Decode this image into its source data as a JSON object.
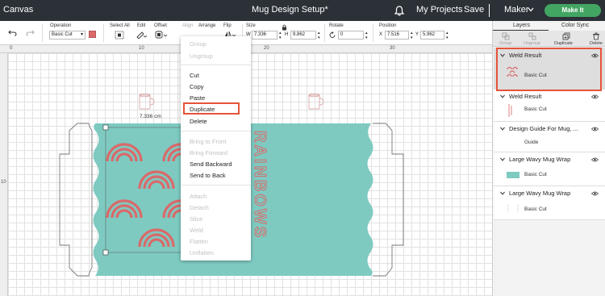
{
  "topbar": {
    "canvas_label": "Canvas",
    "title": "Mug Design Setup*",
    "my_projects": "My Projects",
    "save": "Save",
    "separator": "|",
    "machine": "Maker",
    "make_it": "Make It"
  },
  "toolbar": {
    "undo_icon": "undo-icon",
    "redo_icon": "redo-icon",
    "operation_label": "Operation",
    "operation_value": "Basic Cut",
    "operation_color": "#d96a6a",
    "select_all_label": "Select All",
    "edit_label": "Edit",
    "offset_label": "Offset",
    "align_label": "Align",
    "arrange_label": "Arrange",
    "flip_label": "Flip",
    "size_label": "Size",
    "w_label": "W",
    "w_value": "7.336",
    "h_label": "H",
    "h_value": "9.862",
    "rotate_label": "Rotate",
    "rotate_value": "0",
    "position_label": "Position",
    "x_label": "X",
    "x_value": "7.516",
    "y_label": "Y",
    "y_value": "5.962"
  },
  "rulers": {
    "top_numbers": [
      "0",
      "10",
      "20",
      "30"
    ],
    "left_numbers": [
      "10"
    ]
  },
  "canvas": {
    "dimension_label": "7.336 cm",
    "teal": "#7ecac1",
    "rainbow": "#d96a6a",
    "vertical_word": "RAINBOWS"
  },
  "context_menu": {
    "items": [
      {
        "label": "Group",
        "disabled": true
      },
      {
        "label": "Ungroup",
        "disabled": true
      },
      {
        "label": "Cut",
        "disabled": false
      },
      {
        "label": "Copy",
        "disabled": false
      },
      {
        "label": "Paste",
        "disabled": false
      },
      {
        "label": "Duplicate",
        "disabled": false
      },
      {
        "label": "Delete",
        "disabled": false
      },
      {
        "label": "Bring to Front",
        "disabled": true
      },
      {
        "label": "Bring Forward",
        "disabled": true
      },
      {
        "label": "Send Backward",
        "disabled": false
      },
      {
        "label": "Send to Back",
        "disabled": false
      },
      {
        "label": "Attach",
        "disabled": true
      },
      {
        "label": "Detach",
        "disabled": true
      },
      {
        "label": "Slice",
        "disabled": true
      },
      {
        "label": "Weld",
        "disabled": true
      },
      {
        "label": "Flatten",
        "disabled": true
      },
      {
        "label": "Unflatten",
        "disabled": true
      }
    ]
  },
  "panel": {
    "tab_layers": "Layers",
    "tab_color_sync": "Color Sync",
    "actions": [
      "Group",
      "Ungroup",
      "Duplicate",
      "Delete"
    ],
    "layers": [
      {
        "title": "Weld Result",
        "sub": "Basic Cut",
        "selected": true
      },
      {
        "title": "Weld Result",
        "sub": "Basic Cut",
        "selected": false
      },
      {
        "title": "Design Guide For Mug, ...",
        "sub": "Guide",
        "selected": false
      },
      {
        "title": "Large Wavy Mug Wrap",
        "sub": "Basic Cut",
        "selected": false
      },
      {
        "title": "Large Wavy Mug Wrap",
        "sub": "Basic Cut",
        "selected": false
      }
    ]
  },
  "accent_color": "#e7533a"
}
